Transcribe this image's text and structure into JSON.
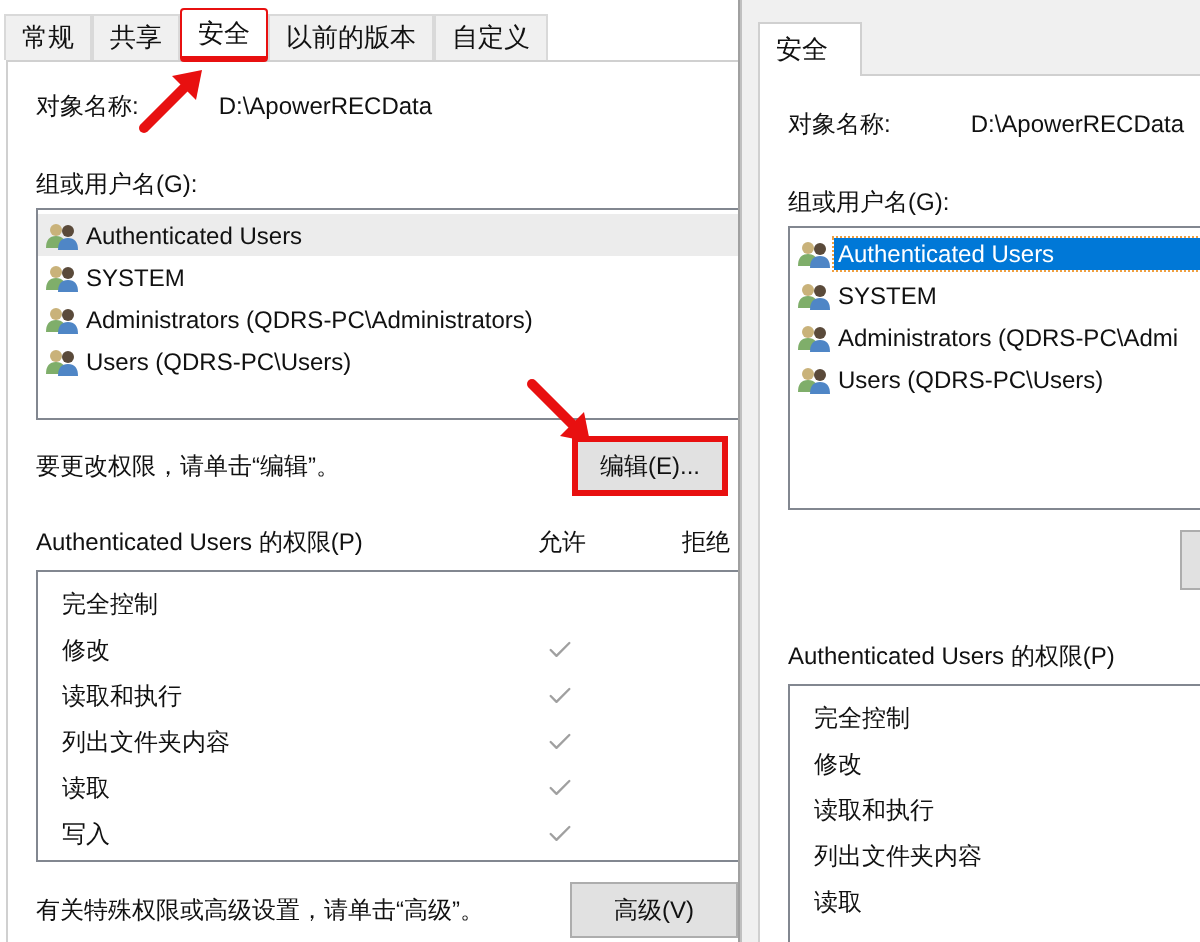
{
  "panels": [
    {
      "kind": "full",
      "tabs": [
        {
          "label": "常规",
          "selected": false,
          "highlighted": false
        },
        {
          "label": "共享",
          "selected": false,
          "highlighted": false
        },
        {
          "label": "安全",
          "selected": true,
          "highlighted": true
        },
        {
          "label": "以前的版本",
          "selected": false,
          "highlighted": false
        },
        {
          "label": "自定义",
          "selected": false,
          "highlighted": false
        }
      ],
      "object_name_label": "对象名称:",
      "object_name": "D:\\ApowerRECData",
      "groups_label": "组或用户名(G):",
      "groups": [
        {
          "name": "Authenticated Users",
          "selected": false,
          "hovered": true
        },
        {
          "name": "SYSTEM",
          "selected": false,
          "hovered": false
        },
        {
          "name": "Administrators (QDRS-PC\\Administrators)",
          "selected": false,
          "hovered": false
        },
        {
          "name": "Users (QDRS-PC\\Users)",
          "selected": false,
          "hovered": false
        }
      ],
      "hint": "要更改权限，请单击“编辑”。",
      "edit_button": {
        "label": "编辑(E)...",
        "highlighted": true
      },
      "permissions_label": "Authenticated Users 的权限(P)",
      "columns": [
        "允许",
        "拒绝"
      ],
      "permissions": [
        {
          "name": "完全控制",
          "allow": false
        },
        {
          "name": "修改",
          "allow": true
        },
        {
          "name": "读取和执行",
          "allow": true
        },
        {
          "name": "列出文件夹内容",
          "allow": true
        },
        {
          "name": "读取",
          "allow": true
        },
        {
          "name": "写入",
          "allow": true
        }
      ],
      "advanced_hint": "有关特殊权限或高级设置，请单击“高级”。",
      "advanced_button": {
        "label": "高级(V)"
      }
    },
    {
      "kind": "partial",
      "tabs": [
        {
          "label": "安全",
          "selected": true,
          "highlighted": false
        }
      ],
      "object_name_label": "对象名称:",
      "object_name": "D:\\ApowerRECData",
      "groups_label": "组或用户名(G):",
      "groups": [
        {
          "name": "Authenticated Users",
          "selected": true,
          "hovered": false
        },
        {
          "name": "SYSTEM",
          "selected": false,
          "hovered": false
        },
        {
          "name": "Administrators (QDRS-PC\\Admi",
          "selected": false,
          "hovered": false
        },
        {
          "name": "Users (QDRS-PC\\Users)",
          "selected": false,
          "hovered": false
        }
      ],
      "edit_button": {
        "highlighted": false
      },
      "permissions_label": "Authenticated Users 的权限(P)",
      "permissions": [
        {
          "name": "完全控制"
        },
        {
          "name": "修改"
        },
        {
          "name": "读取和执行"
        },
        {
          "name": "列出文件夹内容"
        },
        {
          "name": "读取"
        }
      ]
    }
  ]
}
